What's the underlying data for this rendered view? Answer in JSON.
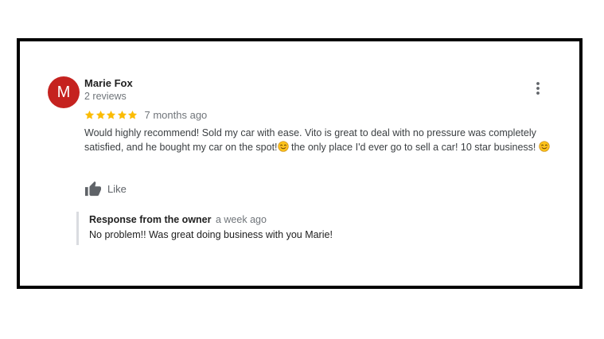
{
  "review": {
    "avatar_initial": "M",
    "reviewer_name": "Marie Fox",
    "review_count": "2 reviews",
    "rating": 5,
    "rating_max": 5,
    "time_ago": "7 months ago",
    "text_part1": "Would highly recommend! Sold my car with ease. Vito is great to deal with no pressure was completely satisfied, and he bought my car on the spot!",
    "text_part2": " the only place I'd ever go to sell a car! 10 star business!",
    "like_label": "Like",
    "emoji_icon": "smiling-face-emoji",
    "star_color": "#fbbc04",
    "avatar_color": "#c5221f"
  },
  "owner_response": {
    "title": "Response from the owner",
    "time_ago": "a week ago",
    "text": "No problem!! Was great doing business with you Marie!"
  }
}
